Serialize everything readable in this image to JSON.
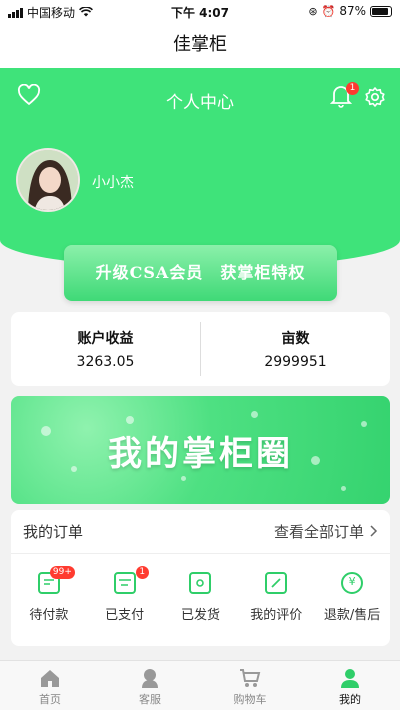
{
  "status_bar": {
    "carrier": "中国移动",
    "time": "下午 4:07",
    "battery": "87%"
  },
  "app_title": "佳掌柜",
  "header": {
    "title": "个人中心",
    "notification_count": "1"
  },
  "profile": {
    "username": "小小杰"
  },
  "promo": {
    "label": "升级CSA会员　获掌柜特权"
  },
  "stats": [
    {
      "label": "账户收益",
      "value": "3263.05"
    },
    {
      "label": "亩数",
      "value": "2999951"
    }
  ],
  "banner": {
    "text": "我的掌柜圈"
  },
  "orders": {
    "title": "我的订单",
    "view_all": "查看全部订单",
    "items": [
      {
        "label": "待付款",
        "badge": "99+",
        "icon": "wallet-icon"
      },
      {
        "label": "已支付",
        "badge": "1",
        "icon": "paid-icon"
      },
      {
        "label": "已发货",
        "badge": "",
        "icon": "delivery-icon"
      },
      {
        "label": "我的评价",
        "badge": "",
        "icon": "review-icon"
      },
      {
        "label": "退款/售后",
        "badge": "",
        "icon": "refund-icon"
      }
    ]
  },
  "tabbar": [
    {
      "label": "首页",
      "icon": "home-icon",
      "active": false
    },
    {
      "label": "客服",
      "icon": "customer-service-icon",
      "active": false
    },
    {
      "label": "购物车",
      "icon": "cart-icon",
      "active": false
    },
    {
      "label": "我的",
      "icon": "user-icon",
      "active": true
    }
  ],
  "colors": {
    "accent": "#3fe37a",
    "badge": "#ff3b30"
  }
}
